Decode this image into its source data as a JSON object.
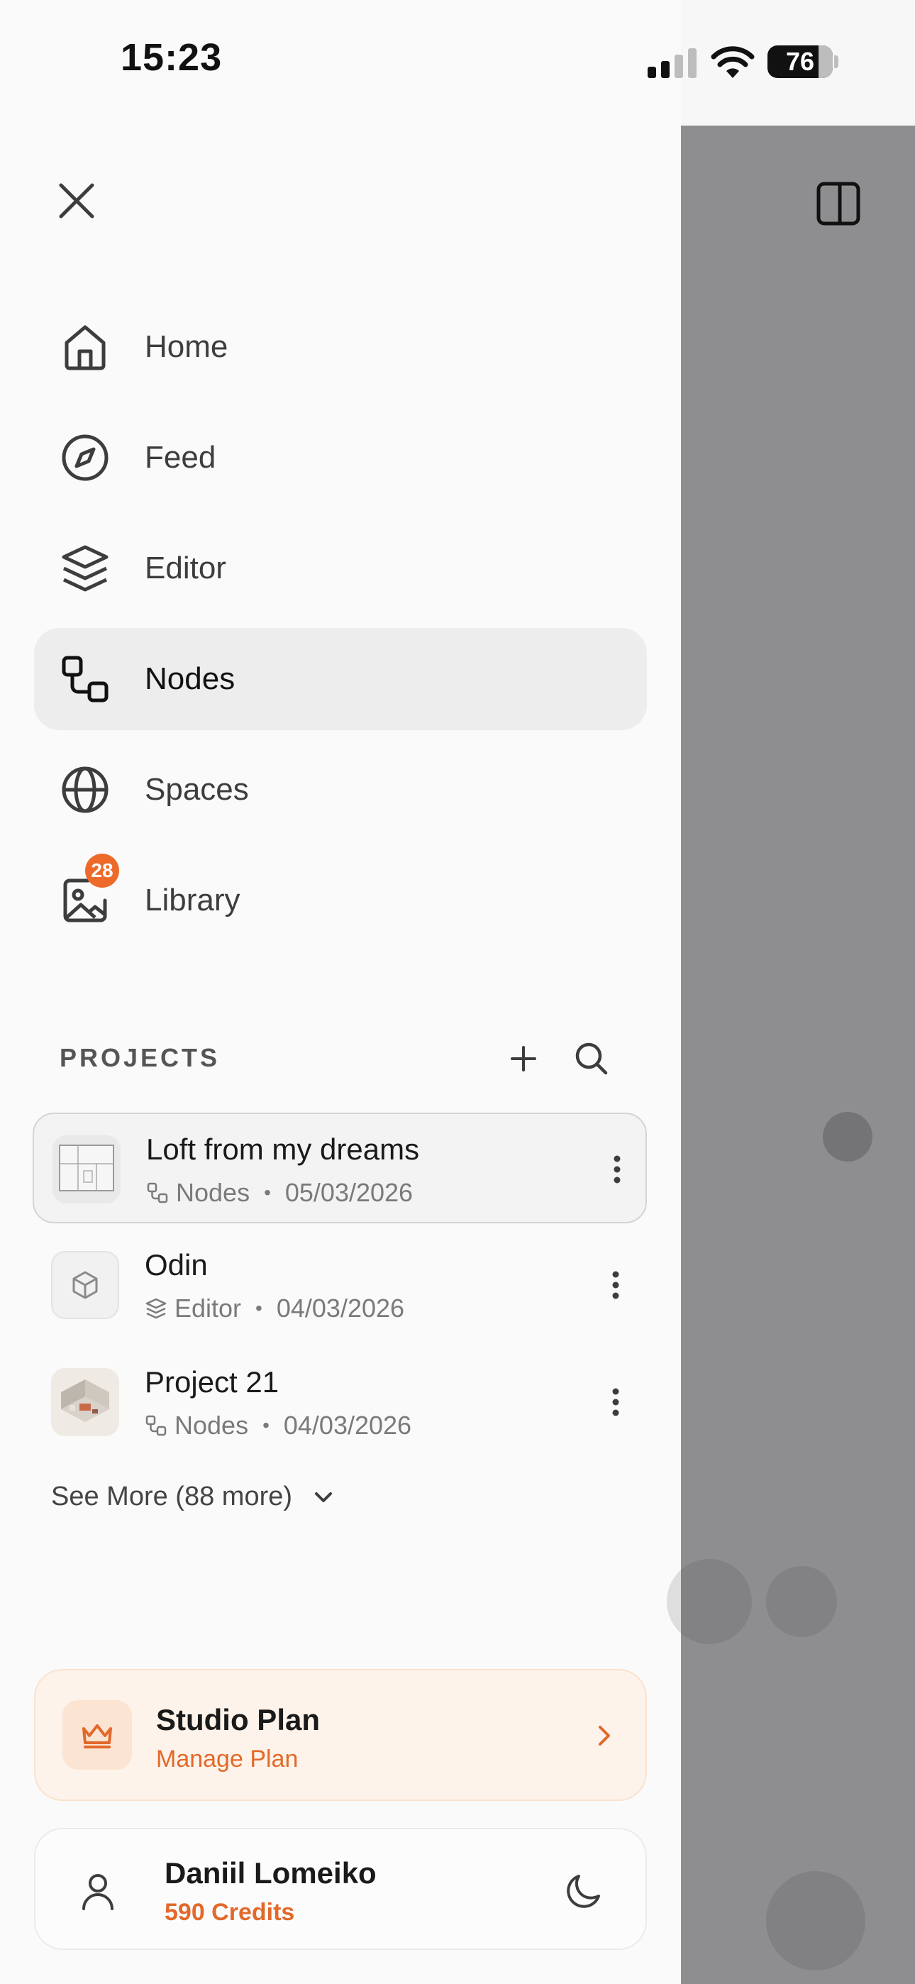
{
  "status": {
    "time": "15:23",
    "battery": "76"
  },
  "nav": [
    {
      "label": "Home",
      "icon": "home-icon"
    },
    {
      "label": "Feed",
      "icon": "compass-icon"
    },
    {
      "label": "Editor",
      "icon": "layers-icon"
    },
    {
      "label": "Nodes",
      "icon": "nodes-icon",
      "active": true
    },
    {
      "label": "Spaces",
      "icon": "globe-icon"
    },
    {
      "label": "Library",
      "icon": "image-icon",
      "badge": "28"
    }
  ],
  "projects": {
    "heading": "PROJECTS",
    "items": [
      {
        "name": "Loft from my dreams",
        "type": "Nodes",
        "date": "05/03/2026",
        "selected": true
      },
      {
        "name": "Odin",
        "type": "Editor",
        "date": "04/03/2026"
      },
      {
        "name": "Project 21",
        "type": "Nodes",
        "date": "04/03/2026"
      }
    ],
    "see_more": "See More (88 more)"
  },
  "plan": {
    "title": "Studio Plan",
    "subtitle": "Manage Plan"
  },
  "user": {
    "name": "Daniil Lomeiko",
    "credits": "590 Credits"
  },
  "colors": {
    "accent": "#e2692b",
    "badge": "#ee6a2a",
    "plan_bg": "#fdf3ea"
  }
}
